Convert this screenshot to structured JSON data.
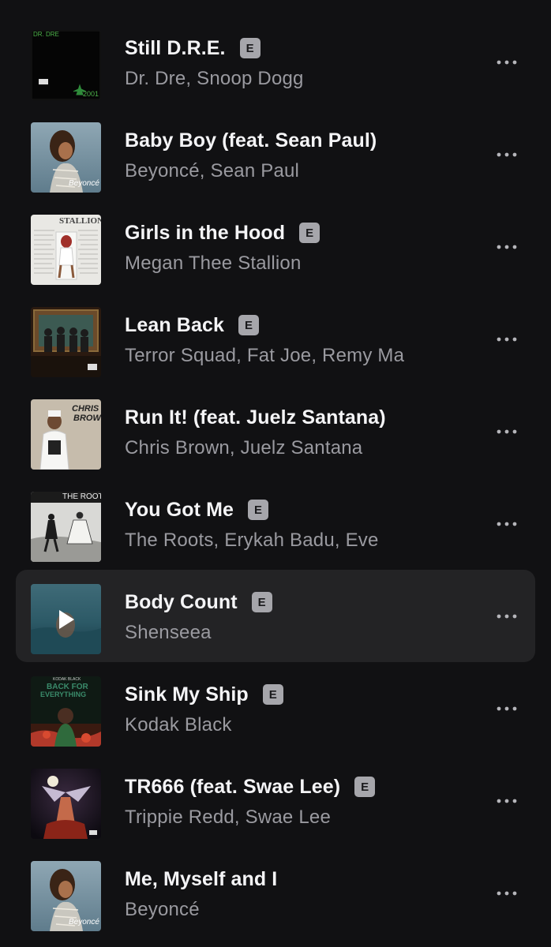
{
  "tracks": [
    {
      "title": "Still D.R.E.",
      "artist": "Dr. Dre, Snoop Dogg",
      "explicit": true,
      "explicit_label": "E",
      "artwork_text": [
        "DR. DRE",
        "2001"
      ],
      "playing": false
    },
    {
      "title": "Baby Boy (feat. Sean Paul)",
      "artist": "Beyoncé, Sean Paul",
      "explicit": false,
      "explicit_label": "",
      "artwork_text": [
        "Beyoncé"
      ],
      "playing": false
    },
    {
      "title": "Girls in the Hood",
      "artist": "Megan Thee Stallion",
      "explicit": true,
      "explicit_label": "E",
      "artwork_text": [
        "STALLION"
      ],
      "playing": false
    },
    {
      "title": "Lean Back",
      "artist": "Terror Squad, Fat Joe, Remy Ma",
      "explicit": true,
      "explicit_label": "E",
      "artwork_text": [],
      "playing": false
    },
    {
      "title": "Run It! (feat. Juelz Santana)",
      "artist": "Chris Brown, Juelz Santana",
      "explicit": false,
      "explicit_label": "",
      "artwork_text": [
        "CHRIS",
        "BROWN"
      ],
      "playing": false
    },
    {
      "title": "You Got Me",
      "artist": "The Roots, Erykah Badu, Eve",
      "explicit": true,
      "explicit_label": "E",
      "artwork_text": [
        "THE ROOTS"
      ],
      "playing": false
    },
    {
      "title": "Body Count",
      "artist": "Shenseea",
      "explicit": true,
      "explicit_label": "E",
      "artwork_text": [],
      "playing": true
    },
    {
      "title": "Sink My Ship",
      "artist": "Kodak Black",
      "explicit": true,
      "explicit_label": "E",
      "artwork_text": [
        "KODAK BLACK",
        "BACK FOR",
        "EVERYTHING"
      ],
      "playing": false
    },
    {
      "title": "TR666 (feat. Swae Lee)",
      "artist": "Trippie Redd, Swae Lee",
      "explicit": true,
      "explicit_label": "E",
      "artwork_text": [],
      "playing": false
    },
    {
      "title": "Me, Myself and I",
      "artist": "Beyoncé",
      "explicit": false,
      "explicit_label": "",
      "artwork_text": [
        "Beyoncé"
      ],
      "playing": false
    }
  ],
  "icons": {
    "more": "more-options-icon",
    "play": "play-icon",
    "explicit": "explicit-badge"
  },
  "colors": {
    "background": "#111113",
    "active_row": "#232325",
    "title": "#f4f4f6",
    "subtitle": "#9a9aa0",
    "badge": "#a6a6ab"
  }
}
